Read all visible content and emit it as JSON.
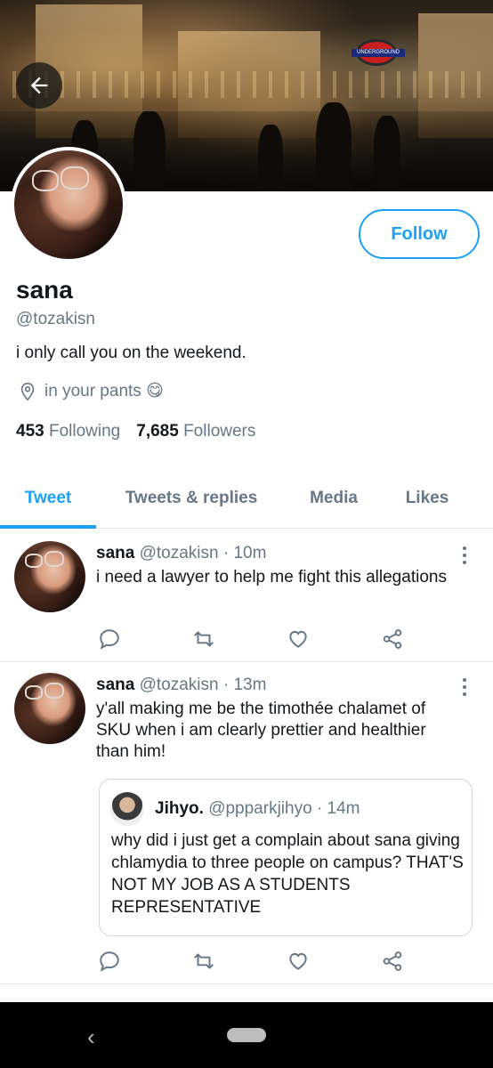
{
  "profile": {
    "name": "sana",
    "handle": "@tozakisn",
    "bio": "i only call you on the weekend.",
    "location": "in your pants 😋",
    "following_count": "453",
    "following_label": "Following",
    "followers_count": "7,685",
    "followers_label": "Followers",
    "follow_label": "Follow"
  },
  "banner": {
    "sign_text": "UNDERGROUND"
  },
  "tabs": [
    {
      "label": "Tweet",
      "active": true
    },
    {
      "label": "Tweets & replies",
      "active": false
    },
    {
      "label": "Media",
      "active": false
    },
    {
      "label": "Likes",
      "active": false
    }
  ],
  "tweets": [
    {
      "name": "sana",
      "handle": "@tozakisn",
      "time": "· 10m",
      "text": "i need a lawyer to help me fight this allegations"
    },
    {
      "name": "sana",
      "handle": "@tozakisn",
      "time": "· 13m",
      "text": "y'all making me be the timothée chalamet of SKU when i am clearly prettier and healthier than him!",
      "quote": {
        "name": "Jihyo.",
        "handle": "@ppparkjihyo",
        "time": "· 14m",
        "text": "why did i just get a complain about sana giving chlamydia to three people on campus? THAT'S NOT MY JOB AS A STUDENTS REPRESENTATIVE"
      }
    }
  ],
  "colors": {
    "accent": "#1da1f2",
    "secondary_text": "#657786",
    "primary_text": "#14171a",
    "divider": "#e1e8ed"
  },
  "icons": [
    "back-arrow-icon",
    "location-pin-icon",
    "reply-icon",
    "retweet-icon",
    "like-icon",
    "share-icon",
    "more-vertical-icon"
  ]
}
